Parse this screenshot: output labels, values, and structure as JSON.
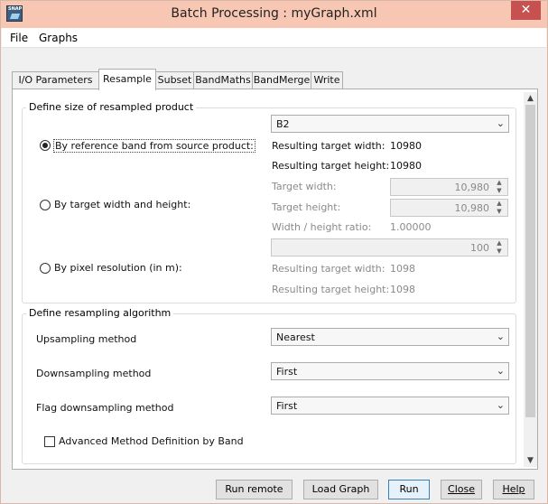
{
  "window": {
    "title": "Batch Processing : myGraph.xml",
    "close_glyph": "✕",
    "app_icon": "snap-icon",
    "app_icon_text": "SNAP"
  },
  "menu": {
    "file": "File",
    "graphs": "Graphs"
  },
  "tabs": [
    {
      "label": "I/O Parameters"
    },
    {
      "label": "Resample"
    },
    {
      "label": "Subset"
    },
    {
      "label": "BandMaths"
    },
    {
      "label": "BandMerge"
    },
    {
      "label": "Write"
    }
  ],
  "active_tab": "Resample",
  "size_group": {
    "legend": "Define size of resampled product",
    "reference_band": {
      "radio_label": "By reference band from source product:",
      "selected": true,
      "band_value": "B2",
      "width_label": "Resulting target width:",
      "width_value": "10980",
      "height_label": "Resulting target height:",
      "height_value": "10980"
    },
    "target_size": {
      "radio_label": "By target width and height:",
      "selected": false,
      "width_label": "Target width:",
      "width_value": "10,980",
      "height_label": "Target height:",
      "height_value": "10,980",
      "ratio_label": "Width / height ratio:",
      "ratio_value": "1.00000"
    },
    "pixel_resolution": {
      "radio_label": "By pixel resolution (in m):",
      "selected": false,
      "resolution_value": "100",
      "width_label": "Resulting target width:",
      "width_value": "1098",
      "height_label": "Resulting target height:",
      "height_value": "1098"
    }
  },
  "algorithm_group": {
    "legend": "Define resampling algorithm",
    "upsampling_label": "Upsampling method",
    "upsampling_value": "Nearest",
    "downsampling_label": "Downsampling method",
    "downsampling_value": "First",
    "flag_downsampling_label": "Flag downsampling method",
    "flag_downsampling_value": "First",
    "advanced_label": "Advanced Method Definition by Band",
    "advanced_checked": false
  },
  "buttons": {
    "run_remote": "Run remote",
    "load_graph": "Load Graph",
    "run": "Run",
    "close": "Close",
    "help": "Help"
  },
  "glyphs": {
    "dropdown": "⌄",
    "spin_up": "▲",
    "spin_down": "▼",
    "scroll_up": "▲",
    "scroll_down": "▼"
  }
}
